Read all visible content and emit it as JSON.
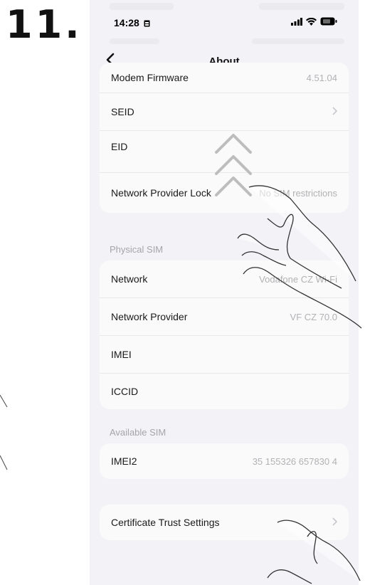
{
  "step_label": "11.",
  "status_bar": {
    "time": "14:28"
  },
  "nav": {
    "title": "About"
  },
  "top_card": {
    "rows": [
      {
        "label": "Modem Firmware",
        "value": "4.51.04"
      },
      {
        "label": "SEID",
        "value": ""
      },
      {
        "label": "EID",
        "value": ""
      },
      {
        "label": "Network Provider Lock",
        "value": "No SIM restrictions"
      }
    ]
  },
  "physical_sim": {
    "header": "Physical SIM",
    "rows": [
      {
        "label": "Network",
        "value": "Vodafone CZ Wi-Fi"
      },
      {
        "label": "Network Provider",
        "value": "VF CZ 70.0"
      },
      {
        "label": "IMEI",
        "value": ""
      },
      {
        "label": "ICCID",
        "value": ""
      }
    ]
  },
  "available_sim": {
    "header": "Available SIM",
    "rows": [
      {
        "label": "IMEI2",
        "value": "35 155326 657830 4"
      }
    ]
  },
  "certificate": {
    "label": "Certificate Trust Settings"
  },
  "icons": {
    "back": "chevron-left-icon",
    "chevron": "chevron-right-icon",
    "swipe": "swipe-up-arrows-icon",
    "hand": "pointing-hand-icon"
  },
  "colors": {
    "background": "#f2f2f7",
    "card": "#fafafa",
    "secondary_text": "#b2b2b6",
    "section_header": "#a5a5aa"
  }
}
